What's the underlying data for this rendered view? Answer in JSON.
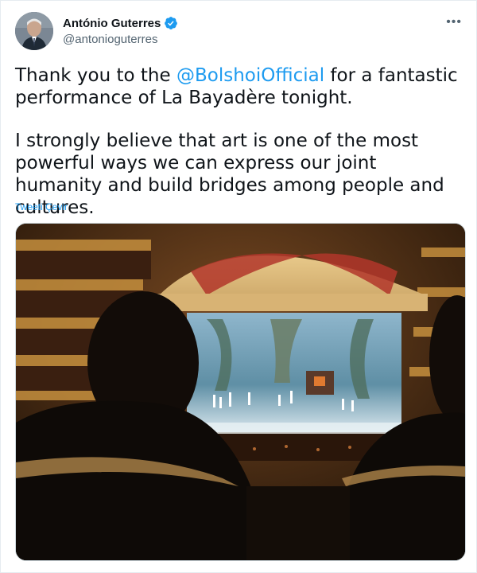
{
  "author": {
    "display_name": "António Guterres",
    "handle": "@antonioguterres",
    "verified": true
  },
  "more_icon": "•••",
  "tweet": {
    "line1_before": "Thank you to the ",
    "mention": "@BolshoiOfficial",
    "line1_after": " for a fantastic performance of La Bayadère tonight.",
    "paragraph2": "I strongly believe that art is one of the most powerful ways we can express our joint humanity and build bridges among people and cultures."
  },
  "translate_label": "Tweeti Çevir",
  "colors": {
    "accent": "#1d9bf0",
    "text": "#0f1419",
    "secondary": "#536471"
  },
  "icons": {
    "verified": "verified-badge-icon",
    "more": "more-options-icon"
  }
}
